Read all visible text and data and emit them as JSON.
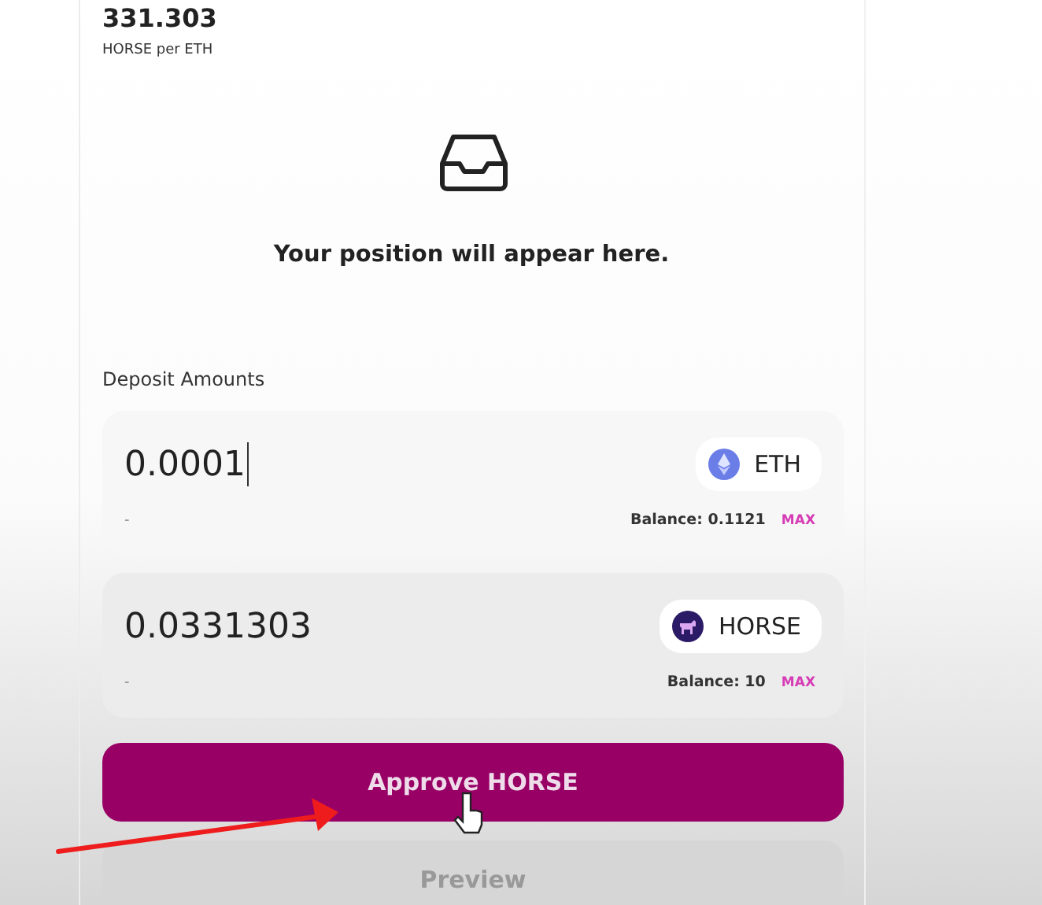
{
  "price": {
    "value": "331.303",
    "label": "HORSE per ETH"
  },
  "empty_state": {
    "text": "Your position will appear here."
  },
  "deposit": {
    "title": "Deposit Amounts",
    "inputs": [
      {
        "value": "0.0001",
        "focused": true,
        "token": {
          "symbol": "ETH",
          "kind": "eth"
        },
        "hint": "-",
        "balance": "Balance: 0.1121",
        "max": "MAX"
      },
      {
        "value": "0.0331303",
        "focused": false,
        "token": {
          "symbol": "HORSE",
          "kind": "horse"
        },
        "hint": "-",
        "balance": "Balance: 10",
        "max": "MAX"
      }
    ]
  },
  "buttons": [
    {
      "label": "Approve HORSE",
      "disabled": false
    },
    {
      "label": "Preview",
      "disabled": true
    }
  ]
}
